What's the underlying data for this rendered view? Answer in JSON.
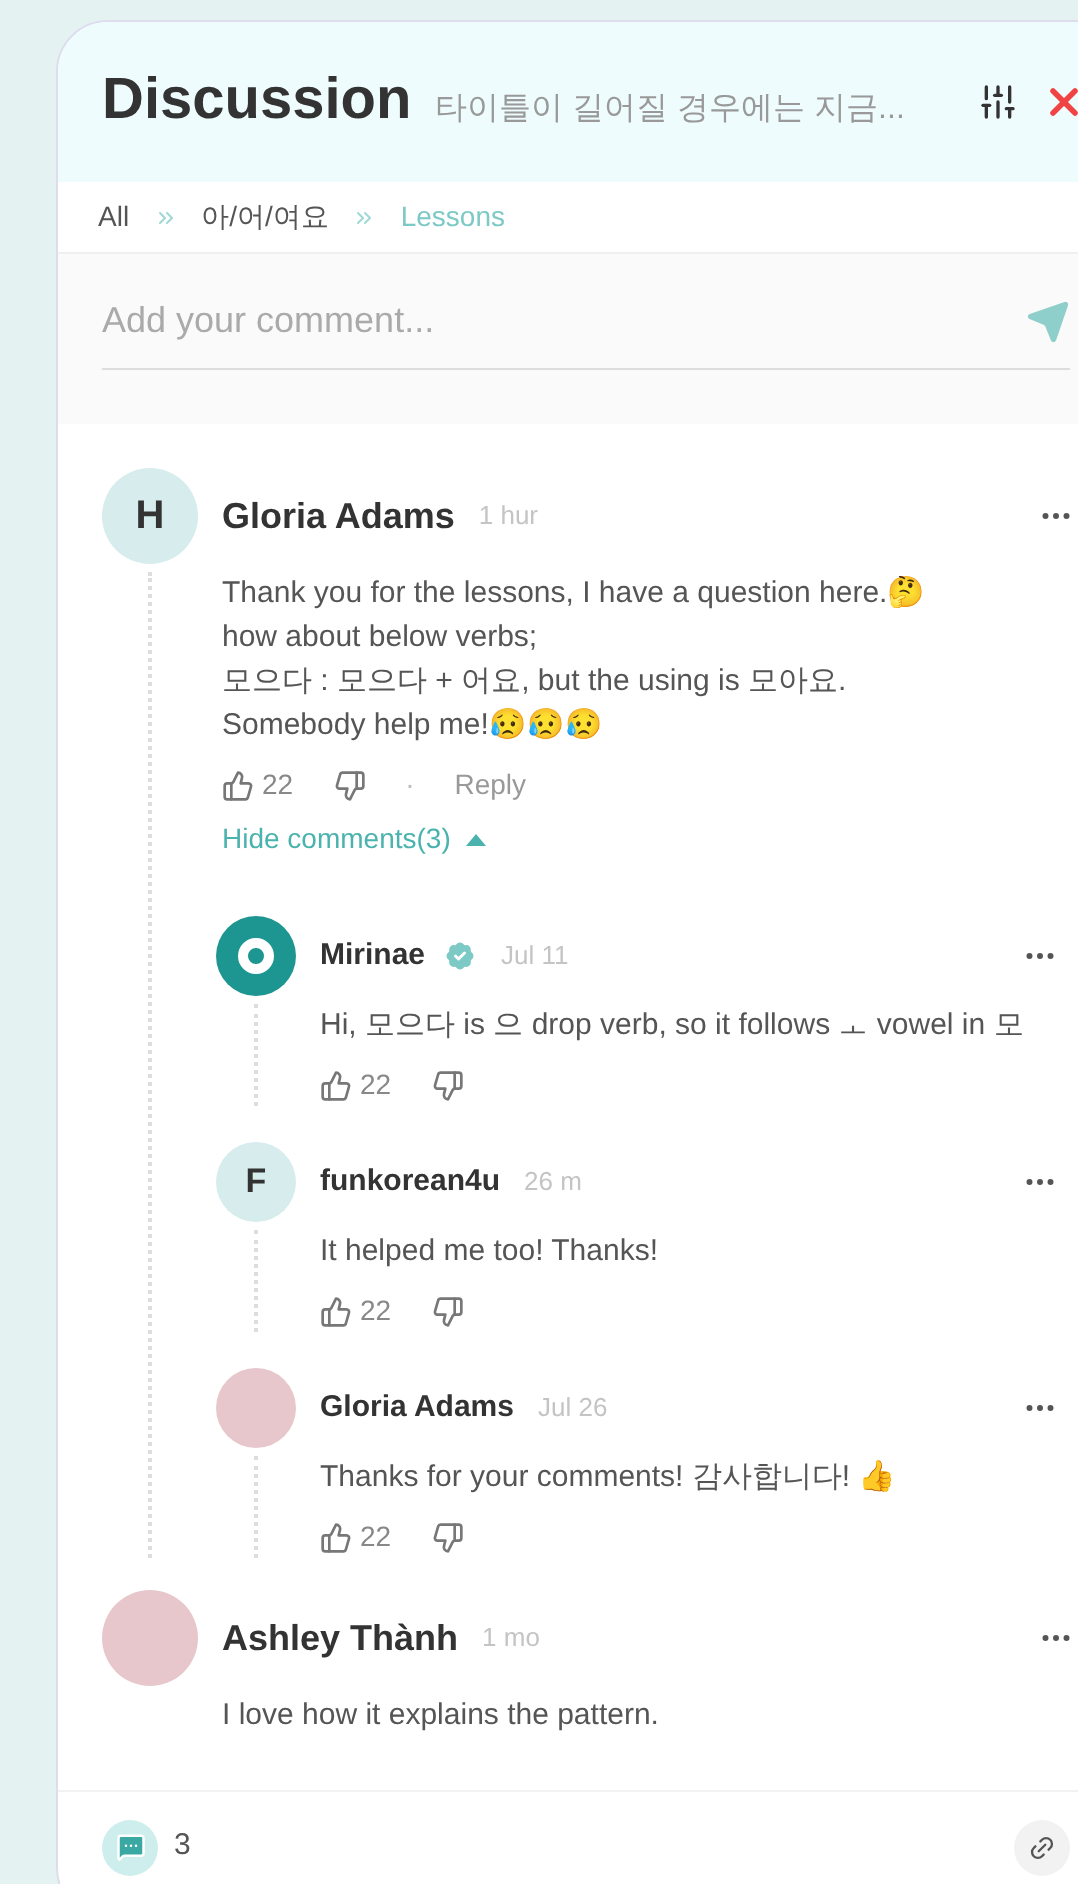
{
  "header": {
    "title": "Discussion",
    "subtitle": "타이틀이 길어질 경우에는 지금..."
  },
  "breadcrumbs": [
    {
      "label": "All",
      "selected": false
    },
    {
      "label": "아/어/여요",
      "selected": false
    },
    {
      "label": "Lessons",
      "selected": true
    }
  ],
  "comment_field": {
    "placeholder": "Add your comment..."
  },
  "comments": [
    {
      "avatar": {
        "kind": "letter",
        "letter": "H"
      },
      "author": "Gloria Adams",
      "verified": false,
      "time": "1 hur",
      "text": "Thank you for the lessons, I have a question here.🤔\nhow about below verbs;\n모으다 : 모으다 + 어요, but the using is 모아요.\nSomebody help me!😥😥😥",
      "likes": "22",
      "separator": "·",
      "reply": "Reply",
      "toggle": {
        "label": "Hide comments(3)",
        "expanded": true
      },
      "children": [
        {
          "avatar": {
            "kind": "logo"
          },
          "author": "Mirinae",
          "verified": true,
          "time": "Jul 11",
          "text": "Hi, 모으다 is 으 drop verb, so it follows ㅗ vowel in 모",
          "likes": "22"
        },
        {
          "avatar": {
            "kind": "letter",
            "letter": "F"
          },
          "author": "funkorean4u",
          "verified": false,
          "time": "26 m",
          "text": "It helped me too! Thanks!",
          "likes": "22"
        },
        {
          "avatar": {
            "kind": "photo"
          },
          "author": "Gloria Adams",
          "verified": false,
          "time": "Jul 26",
          "text": "Thanks for your comments! 감사합니다! 👍",
          "likes": "22"
        }
      ]
    },
    {
      "avatar": {
        "kind": "photo"
      },
      "author": "Ashley Thành",
      "verified": false,
      "time": "1 mo",
      "text": "I love how it explains the pattern."
    }
  ],
  "footer": {
    "comment_count": "3"
  }
}
